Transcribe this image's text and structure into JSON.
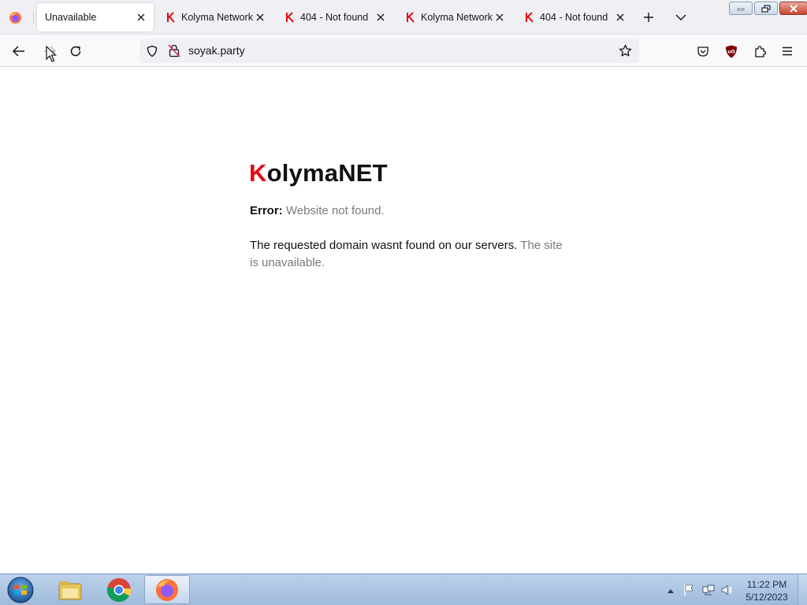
{
  "browser": {
    "tabs": [
      {
        "label": "Unavailable",
        "active": true,
        "favicon": "none"
      },
      {
        "label": "Kolyma Network",
        "active": false,
        "favicon": "kolyma-k-icon"
      },
      {
        "label": "404 - Not found",
        "active": false,
        "favicon": "kolyma-k-icon"
      },
      {
        "label": "Kolyma Network",
        "active": false,
        "favicon": "kolyma-k-icon"
      },
      {
        "label": "404 - Not found",
        "active": false,
        "favicon": "kolyma-k-icon"
      }
    ],
    "url": "soyak.party"
  },
  "page": {
    "brand_first": "K",
    "brand_rest": "olymaNET",
    "error_label": "Error:",
    "error_message": "Website not found.",
    "desc_main": "The requested domain wasnt found on our servers.",
    "desc_grey": "The site is unavailable."
  },
  "taskbar": {
    "clock_time": "11:22 PM",
    "clock_date": "5/12/2023",
    "apps": [
      "windows-explorer-icon",
      "chrome-icon",
      "firefox-icon"
    ]
  },
  "colors": {
    "brand_accent": "#e50914",
    "grey_text": "#7a7a7a"
  }
}
